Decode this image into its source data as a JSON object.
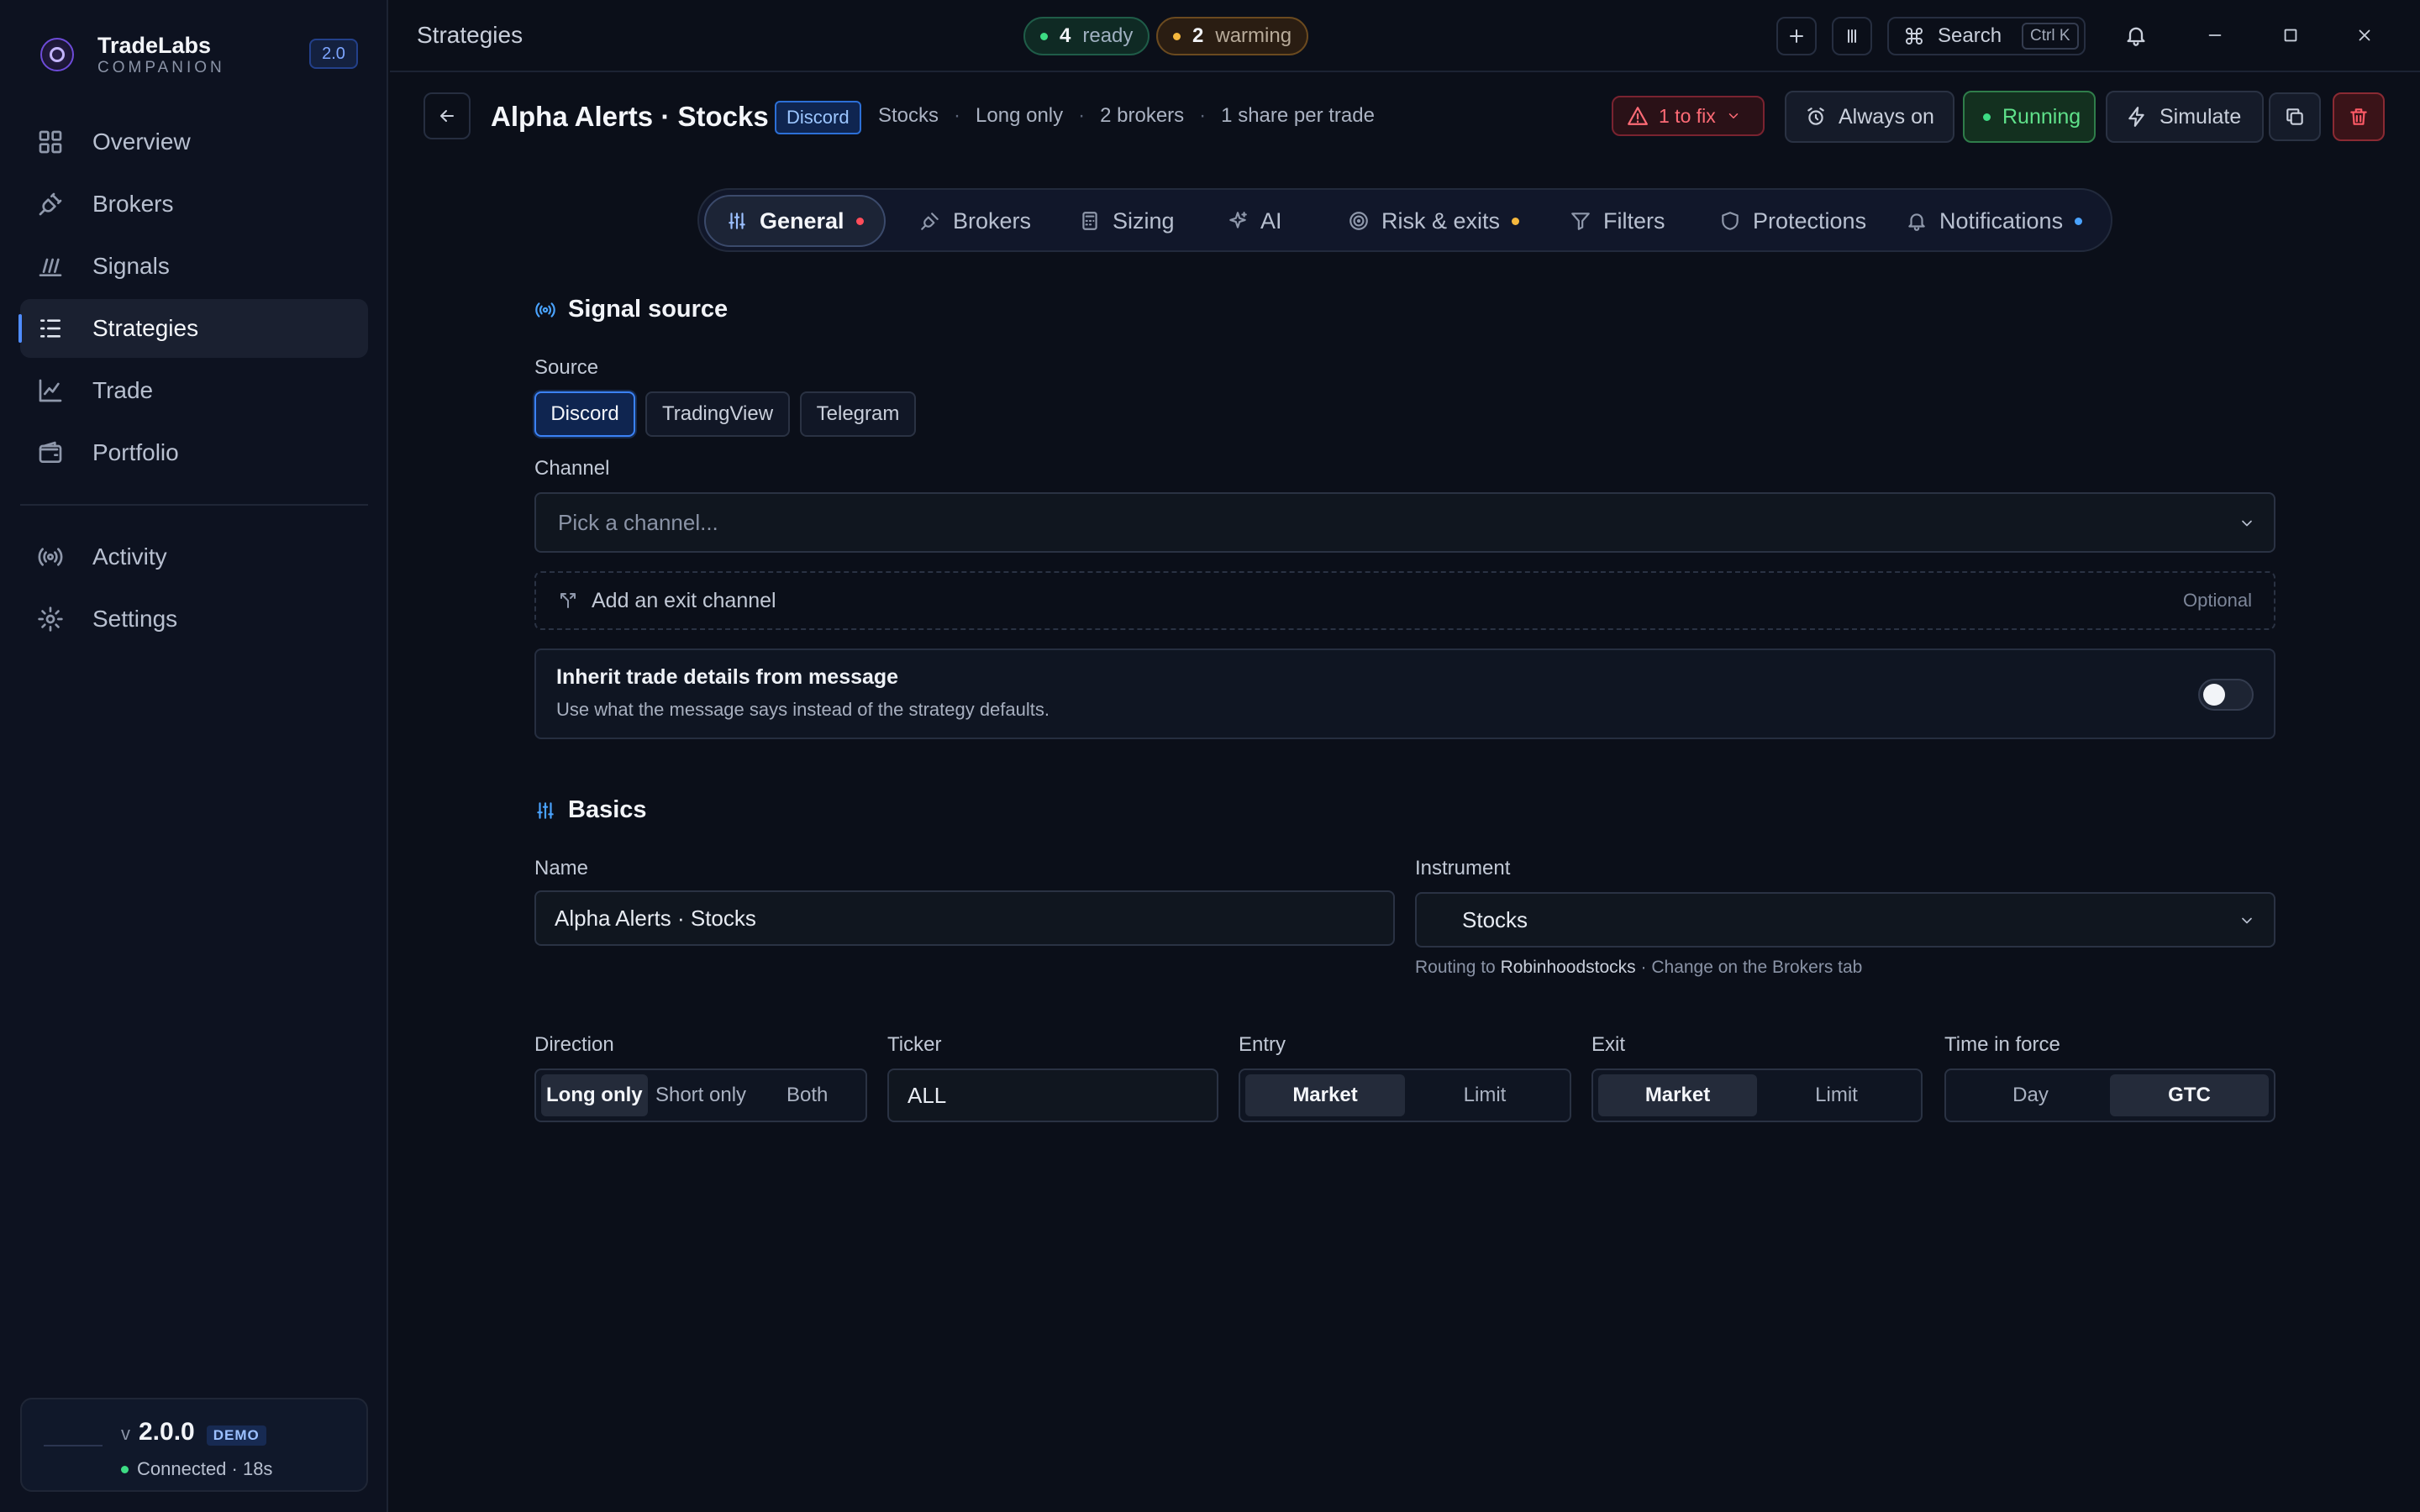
{
  "app": {
    "name": "TradeLabs",
    "subtitle": "COMPANION",
    "version_chip": "2.0"
  },
  "sidebar": {
    "items": [
      {
        "label": "Overview",
        "icon": "grid-icon"
      },
      {
        "label": "Brokers",
        "icon": "plug-icon"
      },
      {
        "label": "Signals",
        "icon": "signal-icon"
      },
      {
        "label": "Strategies",
        "icon": "list-icon",
        "active": true
      },
      {
        "label": "Trade",
        "icon": "chart-line-icon"
      },
      {
        "label": "Portfolio",
        "icon": "wallet-icon"
      }
    ],
    "items2": [
      {
        "label": "Activity",
        "icon": "broadcast-icon"
      },
      {
        "label": "Settings",
        "icon": "gear-icon"
      }
    ],
    "status": {
      "v": "v",
      "version": "2.0.0",
      "badge": "DEMO",
      "connection": "Connected · 18s"
    }
  },
  "topbar": {
    "breadcrumb": "Strategies",
    "ready_count": "4",
    "ready_label": "ready",
    "warming_count": "2",
    "warming_label": "warming",
    "search_label": "Search",
    "search_kbd": "Ctrl K"
  },
  "header": {
    "title": "Alpha Alerts · Stocks",
    "source_chip": "Discord",
    "meta": [
      "Stocks",
      "Long only",
      "2 brokers",
      "1 share per trade"
    ],
    "fix_label": "1 to fix",
    "always_on": "Always on",
    "running": "Running",
    "simulate": "Simulate"
  },
  "tabs": [
    {
      "label": "General",
      "active": true,
      "dot": "red"
    },
    {
      "label": "Brokers"
    },
    {
      "label": "Sizing"
    },
    {
      "label": "AI"
    },
    {
      "label": "Risk & exits",
      "dot": "amber"
    },
    {
      "label": "Filters"
    },
    {
      "label": "Protections"
    },
    {
      "label": "Notifications",
      "dot": "blue"
    }
  ],
  "signal_source": {
    "heading": "Signal source",
    "source_label": "Source",
    "sources": [
      "Discord",
      "TradingView",
      "Telegram"
    ],
    "selected_source": "Discord",
    "channel_label": "Channel",
    "channel_placeholder": "Pick a channel...",
    "exit_channel": "Add an exit channel",
    "exit_optional": "Optional",
    "inherit_title": "Inherit trade details from message",
    "inherit_desc": "Use what the message says instead of the strategy defaults.",
    "inherit_on": false
  },
  "basics": {
    "heading": "Basics",
    "name_label": "Name",
    "name_value": "Alpha Alerts · Stocks",
    "instrument_label": "Instrument",
    "instrument_value": "Stocks",
    "routing_prefix": "Routing to",
    "routing_broker": "Robinhoodstocks",
    "routing_suffix": "· Change on the Brokers tab",
    "direction_label": "Direction",
    "direction_options": [
      "Long only",
      "Short only",
      "Both"
    ],
    "ticker_label": "Ticker",
    "ticker_value": "ALL",
    "entry_label": "Entry",
    "entry_options": [
      "Market",
      "Limit"
    ],
    "exit_label": "Exit",
    "exit_options": [
      "Market",
      "Limit"
    ],
    "tif_label": "Time in force",
    "tif_options": [
      "Day",
      "GTC"
    ]
  },
  "colors": {
    "accent": "#4f8cff",
    "running": "#5fe08a",
    "danger": "#ff4d5a",
    "warning": "#f5b83d"
  }
}
